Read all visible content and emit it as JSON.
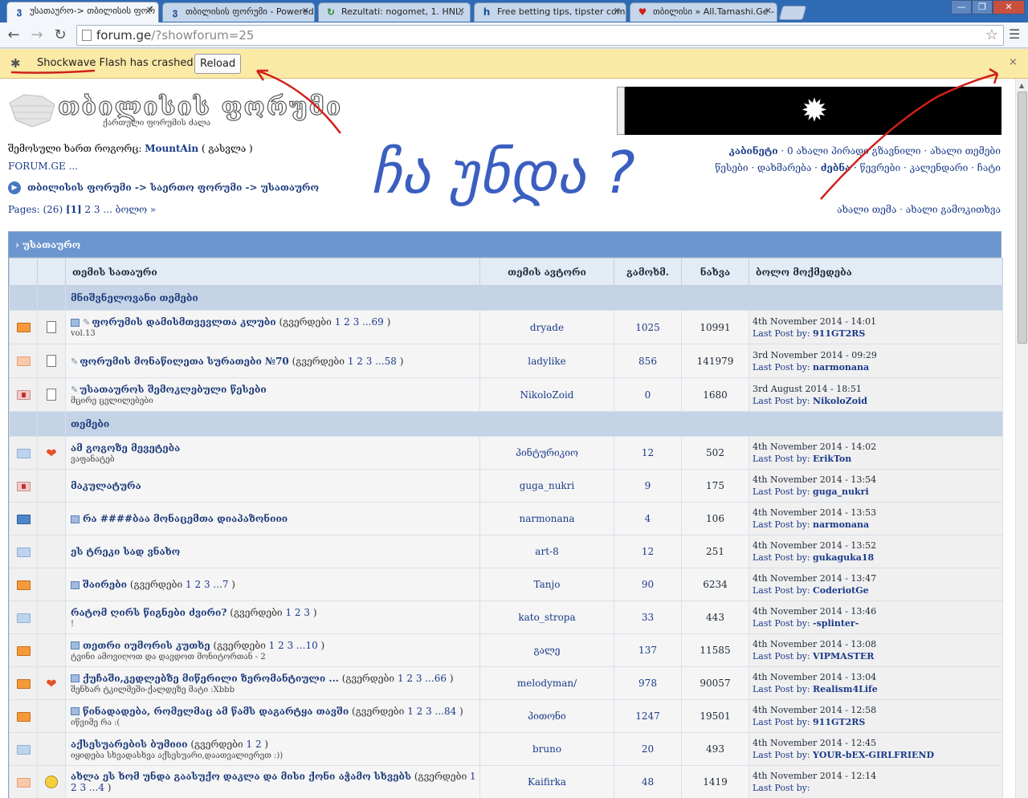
{
  "browser": {
    "tabs": [
      {
        "label": "უსათაურო-> თბილისის ფორ",
        "favicon": "ვ",
        "active": true
      },
      {
        "label": "თბილისის ფორუმი - Powered",
        "favicon": "ვ",
        "active": false
      },
      {
        "label": "Rezultati: nogomet, 1. HNL,",
        "favicon": "↻",
        "active": false
      },
      {
        "label": "Free betting tips, tipster com",
        "favicon": "h",
        "active": false
      },
      {
        "label": "თბილისი » All.Tamashi.Ge - ",
        "favicon": "♥",
        "active": false
      }
    ],
    "url_host": "forum.ge",
    "url_path": "/?showforum=25",
    "window_controls": [
      "—",
      "❐",
      "✕"
    ]
  },
  "infobar": {
    "message": "Shockwave Flash has crashed.",
    "reload_label": "Reload",
    "close": "×"
  },
  "header": {
    "logo_text": "თბილისის ფორუმი",
    "logo_sub": "ქართული ფორუმის ძალა",
    "user_prefix": "შემოსული ხართ როგორც: ",
    "username": "MountAin",
    "logout": " ( გასვლა )",
    "forumge": "FORUM.GE ...",
    "breadcrumb": "თბილისის ფორუმი -> საერთო ფორუმი -> უსათაურო",
    "pages": "Pages: (26) ",
    "pages_current": "[1]",
    "pages_rest": " 2 3 ... ბოლო »",
    "links_line1_bold": "კაბინეტი",
    "links_line1": " · 0 ახალი პირადი გზავნილი · ახალი თემები",
    "links_line2_a": "წესები · დახმარება · ",
    "links_line2_bold": "ძებნა",
    "links_line2_b": " · წევრები · კალენდარი · ჩატი",
    "new_links": "ახალი თემა · ახალი გამოკითხვა"
  },
  "table": {
    "title": "› უსათაურო",
    "headers": [
      "თემის სათაური",
      "თემის ავტორი",
      "გამოხმ.",
      "ნახვა",
      "ბოლო მოქმედება"
    ],
    "sections": [
      "მნიშვნელოვანი თემები",
      "თემები"
    ],
    "pinned": [
      {
        "icon": "orange",
        "doc": true,
        "clip": true,
        "mini": true,
        "title": "ფორუმის დამისმთვევლთა კლუბი",
        "pages": "1 2 3 ...69",
        "desc": "vol.13",
        "author": "dryade",
        "replies": "1025",
        "views": "10991",
        "date": "4th November 2014 - 14:01",
        "last": "911GT2RS"
      },
      {
        "icon": "pale",
        "doc": true,
        "clip": true,
        "mini": false,
        "title": "ფორუმის მონაწილეთა სურათები №70",
        "pages": "1 2 3 ...58",
        "desc": "",
        "author": "ladylike",
        "replies": "856",
        "views": "141979",
        "date": "3rd November 2014 - 09:29",
        "last": "narmonana"
      },
      {
        "icon": "lock",
        "doc": true,
        "clip": true,
        "mini": false,
        "title": "უსათაუროს შემოკლებული წესები",
        "pages": "",
        "desc": "მცირე ცვლილებები",
        "author": "NikoloZoid",
        "replies": "0",
        "views": "1680",
        "date": "3rd August 2014 - 18:51",
        "last": "NikoloZoid"
      }
    ],
    "topics": [
      {
        "icon": "lblue",
        "extra": "heart",
        "mini": false,
        "title": "ამ გოგოზე მევეტება",
        "pages": "",
        "desc": "ვაფანატებ",
        "author": "პინტურიკიო",
        "replies": "12",
        "views": "502",
        "date": "4th November 2014 - 14:02",
        "last": "ErikTon"
      },
      {
        "icon": "lock",
        "extra": "",
        "mini": false,
        "title": "მაკულატურა",
        "pages": "",
        "desc": "",
        "author": "guga_nukri",
        "replies": "9",
        "views": "175",
        "date": "4th November 2014 - 13:54",
        "last": "guga_nukri"
      },
      {
        "icon": "blue",
        "extra": "",
        "mini": true,
        "title": "რა ####ბაა მონაცემთა დიაპაზონიიი",
        "pages": "",
        "desc": "",
        "author": "narmonana",
        "replies": "4",
        "views": "106",
        "date": "4th November 2014 - 13:53",
        "last": "narmonana"
      },
      {
        "icon": "lblue",
        "extra": "",
        "mini": false,
        "title": "ეს ტრეკი სად ვნახო",
        "pages": "",
        "desc": "",
        "author": "art-8",
        "replies": "12",
        "views": "251",
        "date": "4th November 2014 - 13:52",
        "last": "gukaguka18"
      },
      {
        "icon": "orange",
        "extra": "",
        "mini": true,
        "title": "შაირები",
        "pages": "1 2 3 ...7",
        "desc": "",
        "author": "Tanjo",
        "replies": "90",
        "views": "6234",
        "date": "4th November 2014 - 13:47",
        "last": "CoderiotGe"
      },
      {
        "icon": "lblue",
        "extra": "",
        "mini": false,
        "title": "რატომ ღირს წიგნები ძვირი?",
        "pages": "1 2 3",
        "desc": "!",
        "author": "kato_stropa",
        "replies": "33",
        "views": "443",
        "date": "4th November 2014 - 13:46",
        "last": "-splinter-"
      },
      {
        "icon": "orange",
        "extra": "",
        "mini": true,
        "title": "თეთრი იუმორის კუთხე",
        "pages": "1 2 3 ...10",
        "desc": "ტვინი ამოვიღოთ და დავდოთ მონიტორთან - 2",
        "author": "გალე",
        "replies": "137",
        "views": "11585",
        "date": "4th November 2014 - 13:08",
        "last": "VIPMASTER"
      },
      {
        "icon": "orange",
        "extra": "heart",
        "mini": true,
        "title": "ქუჩაში,კედლებზე მიწერილი ზერომანტიული ...",
        "pages": "1 2 3 ...66",
        "desc": "შენხარ ტკილმეში-ქალდეზე მატი :Xbbb",
        "author": "melodyman/",
        "replies": "978",
        "views": "90057",
        "date": "4th November 2014 - 13:04",
        "last": "Realism4Life"
      },
      {
        "icon": "orange",
        "extra": "",
        "mini": true,
        "title": "წინადადება, რომელმაც ამ წამს დაგარტყა თავში",
        "pages": "1 2 3 ...84",
        "desc": "იწვიმე რა :(",
        "author": "პითონი",
        "replies": "1247",
        "views": "19501",
        "date": "4th November 2014 - 12:58",
        "last": "911GT2RS"
      },
      {
        "icon": "lblue",
        "extra": "",
        "mini": false,
        "title": "აქსესუარების ბუმიიი",
        "pages": "1 2",
        "desc": "იყიდება სხვადასხვა აქსესუარი,დაათვალიერეთ :))",
        "author": "bruno",
        "replies": "20",
        "views": "493",
        "date": "4th November 2014 - 12:45",
        "last": "YOUR-bEX-GIRLFRIEND"
      },
      {
        "icon": "pale",
        "extra": "smile",
        "mini": false,
        "title": "ახლა ეს ხომ უნდა გაასუქო დაკლა და მისი ქონი აჭამო სხვებს",
        "pages": "1 2 3 ...4",
        "desc": "",
        "author": "Kaifirka",
        "replies": "48",
        "views": "1419",
        "date": "4th November 2014 - 12:14",
        "last": ""
      }
    ],
    "pages_prefix": "(გვერდები ",
    "pages_suffix": " )",
    "last_prefix": "Last Post by: "
  },
  "annotation": {
    "text": "ჩა უნდა ?",
    "color": "#d0201a"
  },
  "colors": {
    "tabstrip": "#2f6bb5",
    "infobar": "#fbe9a6",
    "table_title": "#6c96cf",
    "section": "#c4d3e6",
    "link": "#1a3a8a"
  }
}
